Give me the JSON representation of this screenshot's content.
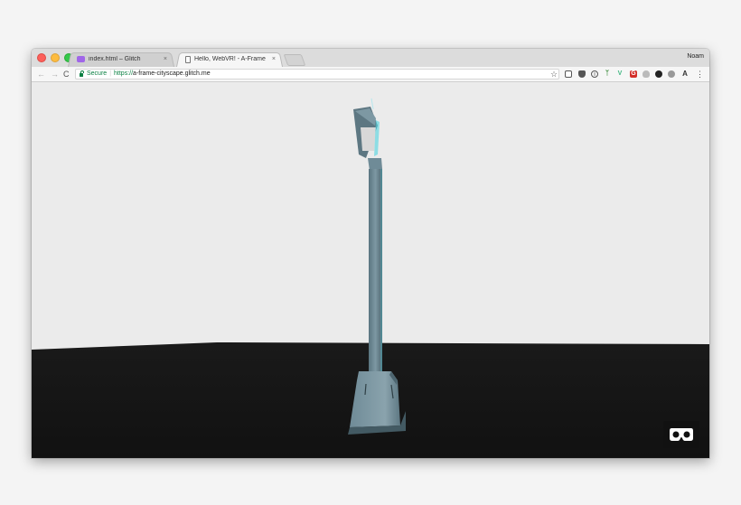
{
  "window": {
    "profile_name": "Noam",
    "traffic_light_colors": {
      "close": "#fc605b",
      "minimize": "#fdbc40",
      "zoom": "#34c84a"
    }
  },
  "tabs": [
    {
      "title": "index.html – Glitch",
      "icon": "glitch-icon",
      "active": false,
      "close": "×"
    },
    {
      "title": "Hello, WebVR! - A-Frame",
      "icon": "page-icon",
      "active": true,
      "close": "×"
    }
  ],
  "toolbar": {
    "back": "←",
    "forward": "→",
    "reload": "C",
    "security_label": "Secure",
    "url_scheme": "https://",
    "url_host": "a-frame-cityscape.glitch.me",
    "bookmark": "☆",
    "menu": "⋮",
    "extensions": [
      {
        "name": "cast-icon",
        "color": "#555555"
      },
      {
        "name": "pocket-icon",
        "color": "#555555"
      },
      {
        "name": "onepassword-icon",
        "color": "#555555"
      },
      {
        "name": "plant-icon",
        "color": "#3a8a3a"
      },
      {
        "name": "vue-devtools-icon",
        "color": "#41b883"
      },
      {
        "name": "lastpass-icon",
        "color": "#d32d27"
      },
      {
        "name": "cloud-icon",
        "color": "#bbbbbb"
      },
      {
        "name": "dark-circle-icon",
        "color": "#222222"
      },
      {
        "name": "ghostery-icon",
        "color": "#999999"
      },
      {
        "name": "font-icon",
        "color": "#333333"
      }
    ]
  },
  "scene": {
    "sky_color": "#ebebeb",
    "ground_color": "#161616",
    "pole_color": "#6f8b97",
    "lamp_glass_color": "#d8d8d8",
    "accent_color": "#4fd3e0"
  },
  "vr_button": {
    "icon": "vr-goggles-icon"
  }
}
